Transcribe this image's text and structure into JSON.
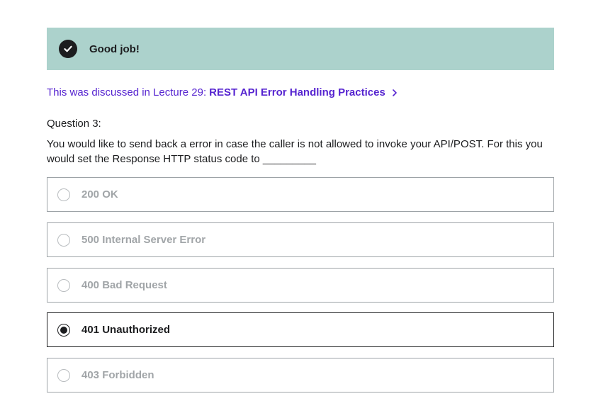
{
  "banner": {
    "icon": "check-circle-icon",
    "message": "Good job!",
    "background": "#acd2cc"
  },
  "lecture": {
    "prefix": "This was discussed in Lecture 29:",
    "link_text": "REST API Error Handling Practices",
    "icon": "chevron-right-icon",
    "color": "#5624d0"
  },
  "question": {
    "number_label": "Question 3:",
    "text": "You would like to send back a error in case the caller is not allowed to invoke your API/POST. For this you would set the Response HTTP status code to _________"
  },
  "options": [
    {
      "label": "200 OK",
      "selected": false
    },
    {
      "label": "500 Internal Server Error",
      "selected": false
    },
    {
      "label": "400 Bad Request",
      "selected": false
    },
    {
      "label": "401 Unauthorized",
      "selected": true
    },
    {
      "label": "403 Forbidden",
      "selected": false
    }
  ]
}
